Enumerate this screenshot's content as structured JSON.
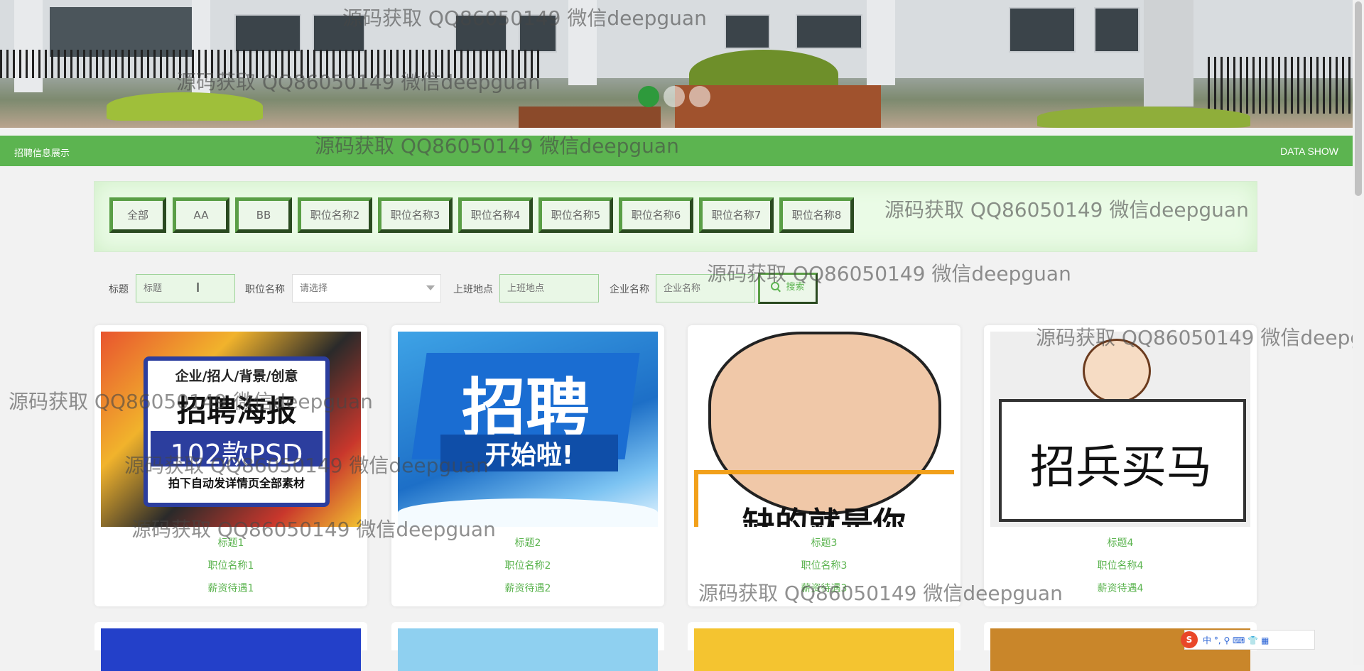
{
  "nav": {
    "section_title": "招聘信息展示",
    "right_text": "DATA SHOW"
  },
  "categories": [
    "全部",
    "AA",
    "BB",
    "职位名称2",
    "职位名称3",
    "职位名称4",
    "职位名称5",
    "职位名称6",
    "职位名称7",
    "职位名称8"
  ],
  "search": {
    "title_label": "标题",
    "title_placeholder": "标题",
    "position_label": "职位名称",
    "position_placeholder": "请选择",
    "location_label": "上班地点",
    "location_placeholder": "上班地点",
    "company_label": "企业名称",
    "company_placeholder": "企业名称",
    "button_label": "搜索"
  },
  "cards": [
    {
      "title": "标题1",
      "position": "职位名称1",
      "salary": "薪资待遇1",
      "poster": {
        "line1": "企业/招人/背景/创意",
        "line2": "招聘海报",
        "line3": "102款PSD",
        "line4": "拍下自动发详情页全部素材"
      }
    },
    {
      "title": "标题2",
      "position": "职位名称2",
      "salary": "薪资待遇2",
      "poster": {
        "line1": "招聘",
        "line2": "开始啦!"
      }
    },
    {
      "title": "标题3",
      "position": "职位名称3",
      "salary": "薪资待遇3",
      "poster": {
        "line1": "缺的就是你"
      }
    },
    {
      "title": "标题4",
      "position": "职位名称4",
      "salary": "薪资待遇4",
      "poster": {
        "line1": "招兵买马"
      }
    }
  ],
  "watermark": "源码获取 QQ86050149 微信deepguan",
  "ime": {
    "logo": "S",
    "chars": "中 °, ⚲ ⌨ 👕 ▦"
  },
  "carousel": {
    "count": 3,
    "active": 0
  },
  "colors": {
    "brand": "#5cb450",
    "button_border": "#5a9e46"
  }
}
